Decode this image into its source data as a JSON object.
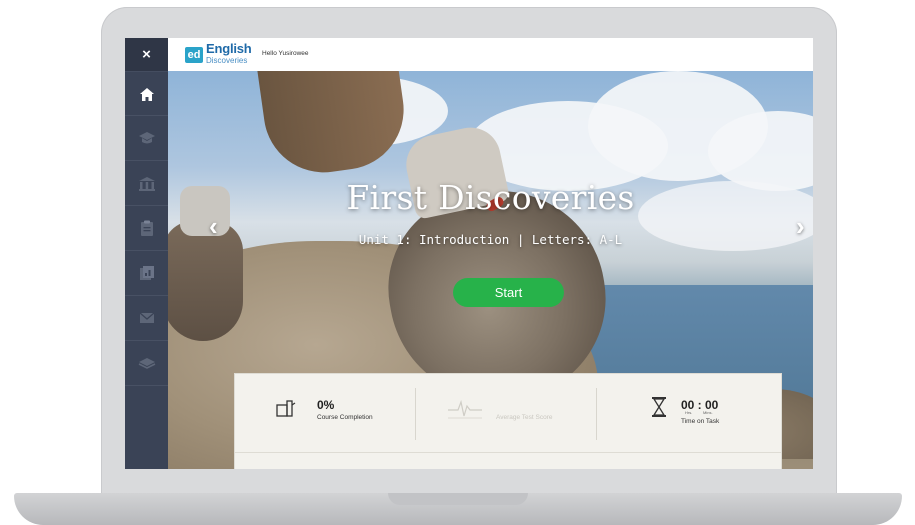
{
  "sidebar": {
    "close_label": "×",
    "items": [
      {
        "icon": "home-icon",
        "active": true
      },
      {
        "icon": "graduation-cap-icon",
        "active": false
      },
      {
        "icon": "school-icon",
        "active": false
      },
      {
        "icon": "clipboard-icon",
        "active": false
      },
      {
        "icon": "reports-icon",
        "active": false
      },
      {
        "icon": "mail-icon",
        "active": false
      },
      {
        "icon": "book-icon",
        "active": false
      }
    ]
  },
  "topbar": {
    "logo_badge": "ed",
    "logo_title": "English",
    "logo_subtitle": "Discoveries",
    "greeting": "Hello Yusirowee"
  },
  "hero": {
    "title": "First Discoveries",
    "subtitle": "Unit 1: Introduction | Letters: A-L",
    "start_label": "Start",
    "prev_arrow": "‹",
    "next_arrow": "›"
  },
  "stats": {
    "completion_value": "0%",
    "completion_label": "Course Completion",
    "test_score_label": "Average Test Score",
    "time_value": "00 : 00",
    "time_hrs_label": "Hrs.",
    "time_mins_label": "Mins.",
    "time_label": "Time on Task"
  },
  "colors": {
    "sidebar_bg": "#3a4356",
    "start_button": "#27b24a",
    "logo_blue": "#1f6aa8",
    "logo_badge": "#2aa3c9"
  }
}
